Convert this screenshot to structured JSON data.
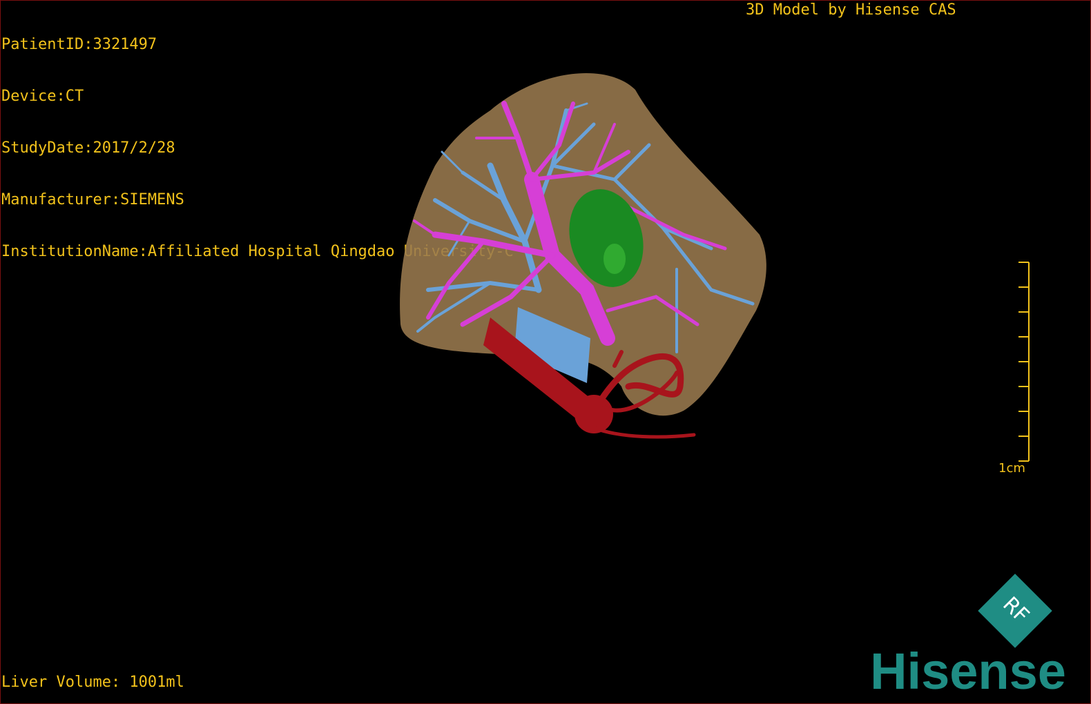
{
  "overlay": {
    "patient_id": "PatientID:3321497",
    "device": "Device:CT",
    "study_date": "StudyDate:2017/2/28",
    "manufacturer": "Manufacturer:SIEMENS",
    "institution": "InstitutionName:Affiliated Hospital Qingdao University-C",
    "model_credit": "3D Model by Hisense CAS",
    "liver_volume": "Liver Volume: 1001ml"
  },
  "scale_bar": {
    "label": "1cm"
  },
  "logo": {
    "badge_text": "RF",
    "brand": "Hisense"
  },
  "colors": {
    "text": "#f2c21b",
    "liver": "#9a7a4e",
    "portal_vein": "#d63fd6",
    "hepatic_vein": "#6aa2d8",
    "artery": "#a8141c",
    "tumor": "#1a8a22",
    "brand": "#1f8d84"
  }
}
